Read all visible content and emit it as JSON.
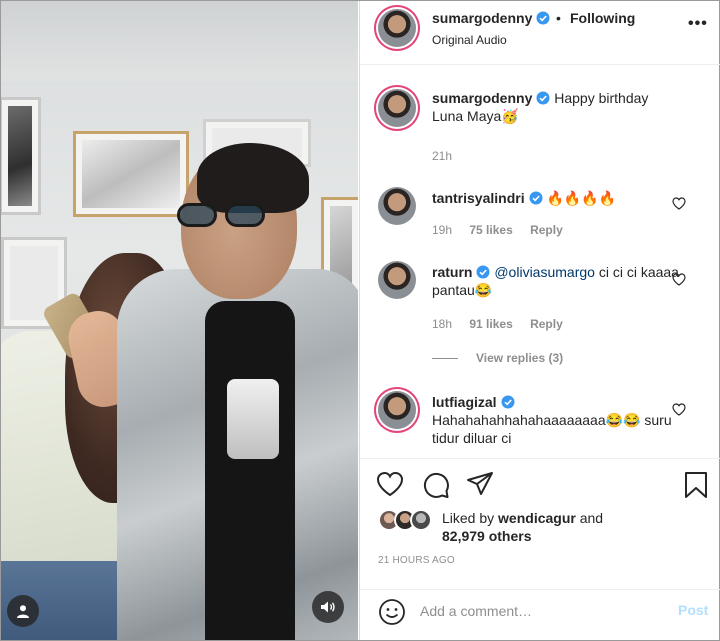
{
  "post": {
    "username": "sumargodenny",
    "separator": "•",
    "follow_status": "Following",
    "audio": "Original Audio",
    "more_label": "•••",
    "caption": {
      "username": "sumargodenny",
      "text": "Happy birthday Luna Maya🥳",
      "time": "21h"
    }
  },
  "comments": [
    {
      "username": "tantrisyalindri",
      "text": "🔥🔥🔥🔥",
      "time": "19h",
      "likes": "75 likes",
      "reply": "Reply"
    },
    {
      "username": "raturn",
      "mention": "@oliviasumargo",
      "text": " ci ci ci kaaaa pantau😂",
      "time": "18h",
      "likes": "91 likes",
      "reply": "Reply",
      "view_replies": "View replies (3)"
    },
    {
      "username": "lutfiagizal",
      "text": "Hahahahahhahahaaaaaaaa😂😂 suru tidur diluar ci"
    }
  ],
  "likes": {
    "prefix": "Liked by ",
    "liker": "wendicagur",
    "suffix": " and",
    "count": "82,979 others"
  },
  "timestamp": "21 HOURS AGO",
  "add_comment": {
    "placeholder": "Add a comment…",
    "post_label": "Post"
  },
  "colors": {
    "verified": "#3897f0",
    "story_ring": "#e3457a",
    "post_disabled": "#b2dffc",
    "mention": "#00376b"
  }
}
